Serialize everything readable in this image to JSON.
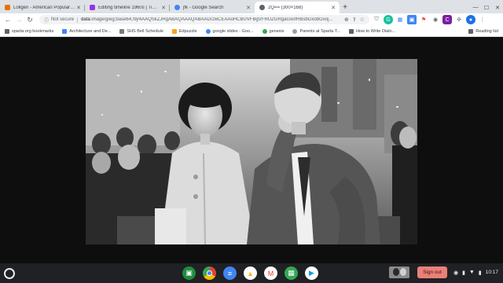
{
  "tabs": [
    {
      "title": "Lollgen - American Popular Cult",
      "favicon_color": "#e37400",
      "active": false
    },
    {
      "title": "Editing timeline 1960s | Timeto",
      "favicon_color": "#9334e6",
      "active": false
    },
    {
      "title": "jfk - Google Search",
      "favicon_color": "#4285f4",
      "active": false
    },
    {
      "title": "2Q== (300×168)",
      "favicon_color": "#5f6368",
      "active": true
    }
  ],
  "toolbar": {
    "security_label": "Not secure",
    "url_prefix": "data",
    "url_rest": ":image/jpeg;base64,/9j/4AAQSkZJRgABAQAAAQABAAD/2wCEAAoHCBUVFBgVFRUZGRgaGxofHBsbGxobGxoj..."
  },
  "bookmarks": [
    {
      "label": "sparta.org bookmarks",
      "color": "#5f6368"
    },
    {
      "label": "Architecture and De...",
      "color": "#4285f4"
    },
    {
      "label": "SHS Bell Schedule",
      "color": "#7a7a7a"
    },
    {
      "label": "Edpuzzle",
      "color": "#f4a81d"
    },
    {
      "label": "google slides - Goo...",
      "color": "#4285f4"
    },
    {
      "label": "genesis",
      "color": "#34a853"
    },
    {
      "label": "Parents at Sparta T...",
      "color": "#9aa0a6"
    },
    {
      "label": "How to Write Dialo...",
      "color": "#5f6368"
    }
  ],
  "reading_list": "Reading list",
  "shelf": {
    "sign_out": "Sign out",
    "time": "10:17",
    "apps": [
      {
        "name": "classroom",
        "color": "#1e8e3e"
      },
      {
        "name": "chrome",
        "color": "#db4437"
      },
      {
        "name": "docs",
        "color": "#4285f4"
      },
      {
        "name": "drive",
        "color": "#fbbc04"
      },
      {
        "name": "gmail",
        "color": "#ea4335"
      },
      {
        "name": "sheets",
        "color": "#34a853"
      },
      {
        "name": "play",
        "color": "#00a3e0"
      }
    ]
  }
}
